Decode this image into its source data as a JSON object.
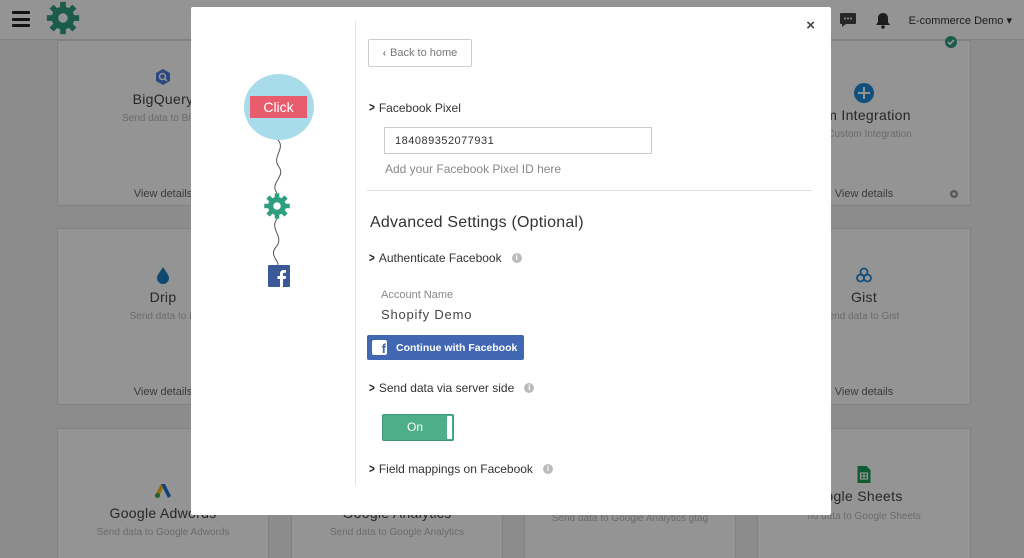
{
  "topbar": {
    "account_label": "E-commerce Demo"
  },
  "background_cards": [
    {
      "title": "BigQuery",
      "desc": "Send data to BigQ",
      "details": "View details"
    },
    {
      "title": "om Integration",
      "desc": "to Custom Integration",
      "details": "View details"
    },
    {
      "title": "Drip",
      "desc": "Send data to D",
      "details": "View details"
    },
    {
      "title": "Gist",
      "desc": "end data to Gist",
      "details": "View details"
    },
    {
      "title": "Google Adwords",
      "desc": "Send data to Google Adwords"
    },
    {
      "title": "Google Analytics",
      "desc": "Send data to Google Analytics"
    },
    {
      "title": "",
      "desc": "Send data to Google Analytics gtag"
    },
    {
      "title": "ogle Sheets",
      "desc": "nd data to Google Sheets"
    }
  ],
  "modal": {
    "close_label": "×",
    "illustration": {
      "click_label": "Click"
    },
    "back_label": "Back to home",
    "pixel_section_label": "Facebook Pixel",
    "pixel_id_value": "184089352077931",
    "pixel_hint": "Add your Facebook Pixel ID here",
    "advanced_title": "Advanced Settings (Optional)",
    "authenticate_label": "Authenticate Facebook",
    "account_name_label": "Account Name",
    "account_name_value": "Shopify Demo",
    "continue_fb_label": "Continue with Facebook",
    "server_side_label": "Send data via server side",
    "toggle_label": "On",
    "field_mappings_label": "Field mappings on Facebook"
  },
  "colors": {
    "accent_green": "#2e9e7e",
    "facebook_blue": "#4267b2",
    "click_red": "#e85d6e",
    "bubble_blue": "#a9dcea",
    "toggle_green": "#4caf8a"
  }
}
